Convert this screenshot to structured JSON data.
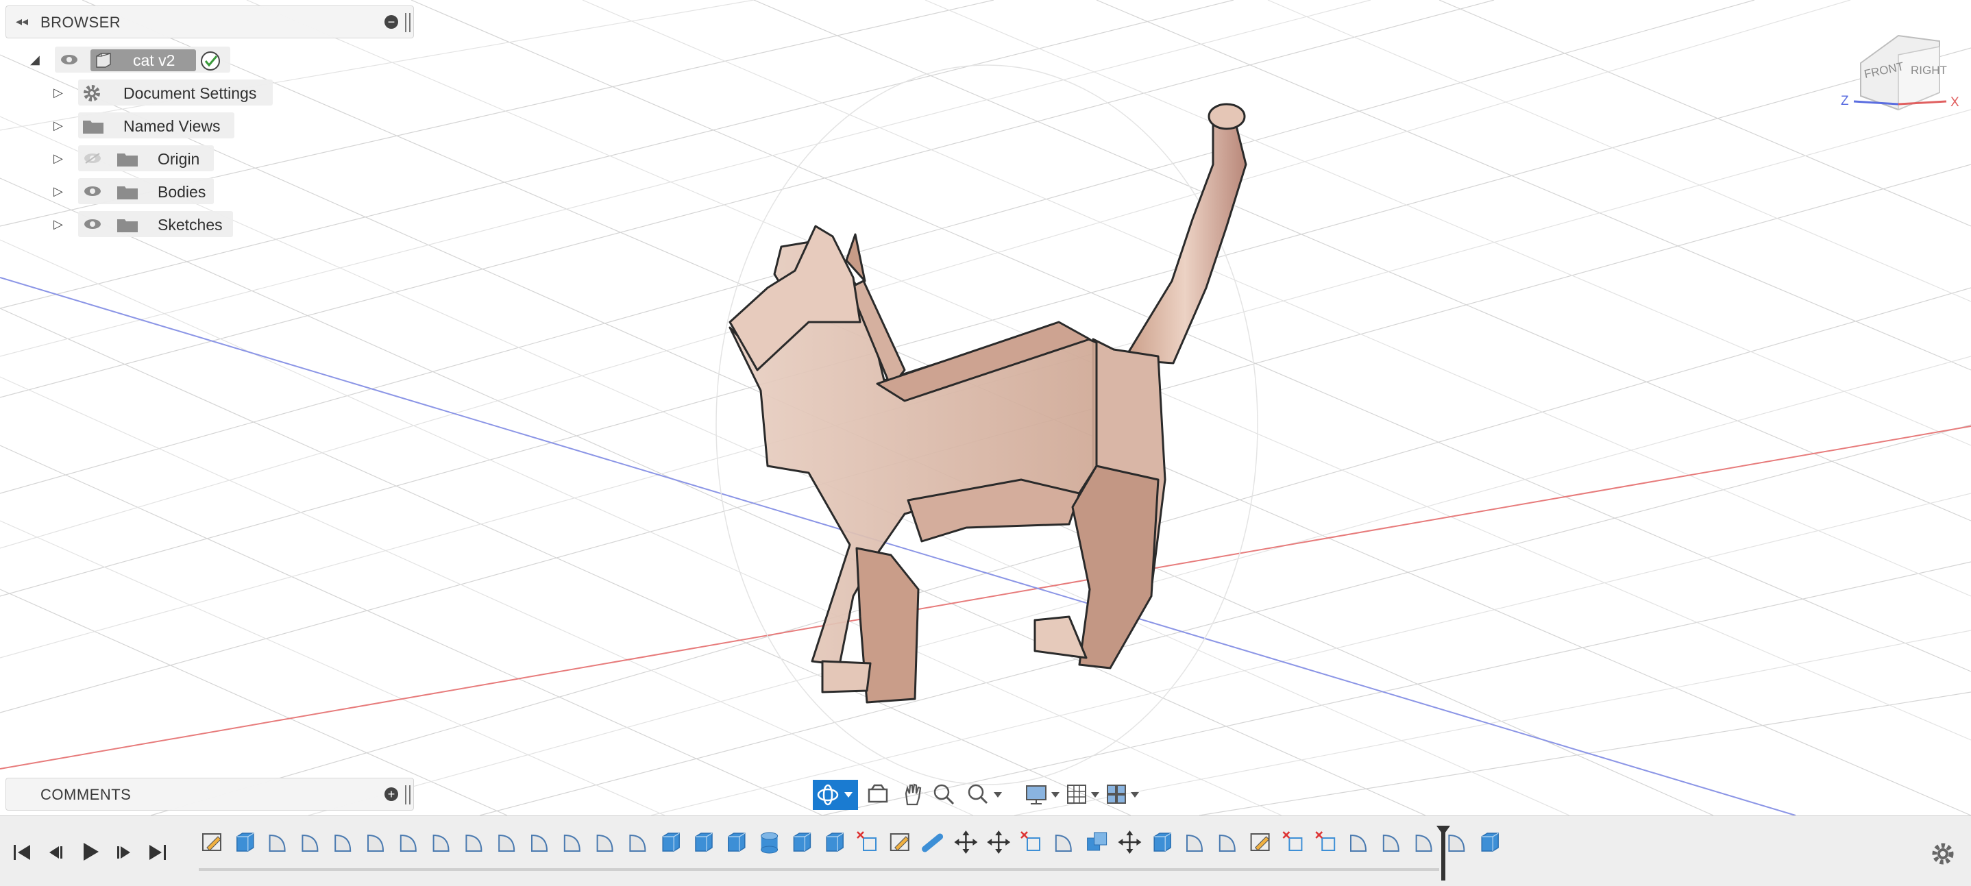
{
  "browser": {
    "title": "BROWSER",
    "root": {
      "label": "cat v2"
    },
    "items": [
      {
        "label": "Document Settings"
      },
      {
        "label": "Named Views"
      },
      {
        "label": "Origin"
      },
      {
        "label": "Bodies"
      },
      {
        "label": "Sketches"
      }
    ]
  },
  "comments": {
    "title": "COMMENTS"
  },
  "viewcube": {
    "front": "FRONT",
    "right": "RIGHT",
    "axis_z": "Z",
    "axis_x": "X"
  },
  "nav_toolbar": {
    "items": [
      "orbit-icon",
      "look-at-icon",
      "pan-icon",
      "zoom-icon",
      "fit-icon",
      "display-settings-icon",
      "grid-snap-icon",
      "viewports-icon"
    ]
  },
  "timeline": {
    "controls": [
      "go-to-start",
      "step-back",
      "play",
      "step-forward",
      "go-to-end"
    ],
    "features": [
      "sketch",
      "extrude",
      "fillet",
      "fillet",
      "fillet",
      "fillet",
      "fillet",
      "fillet",
      "fillet",
      "fillet",
      "fillet",
      "fillet",
      "fillet",
      "fillet",
      "extrude",
      "extrude",
      "extrude",
      "cylinder",
      "extrude",
      "extrude",
      "delete-sketch",
      "sketch",
      "pipe",
      "move",
      "move",
      "delete-sketch",
      "fillet",
      "combine",
      "move",
      "extrude",
      "fillet",
      "fillet",
      "sketch",
      "delete-sketch",
      "delete-sketch",
      "fillet",
      "fillet",
      "fillet",
      "fillet",
      "box"
    ]
  },
  "colors": {
    "accent": "#1a7bd1",
    "model": "#d7b8a8",
    "x_axis": "#e06a6a",
    "z_axis": "#6a7ae0"
  }
}
